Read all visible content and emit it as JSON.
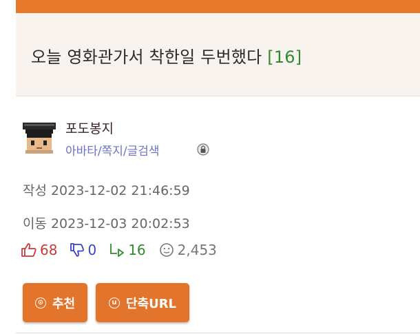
{
  "post": {
    "title": "오늘 영화관가서 착한일 두번했다",
    "comment_count": "[16]"
  },
  "author": {
    "nickname": "포도봉지",
    "links": "아바타/쪽지/글검색"
  },
  "meta": {
    "created_label": "작성",
    "created_value": "2023-12-02 21:46:59",
    "moved_label": "이동",
    "moved_value": "2023-12-03 20:02:53"
  },
  "stats": {
    "upvotes": "68",
    "downvotes": "0",
    "replies": "16",
    "views": "2,453"
  },
  "buttons": {
    "recommend": "추천",
    "recommend_icon": "⊙",
    "short_url": "단축URL",
    "short_url_icon": "u"
  },
  "colors": {
    "accent": "#e7792b",
    "upvote": "#c43b3b",
    "downvote": "#3546c2",
    "reply": "#2e8b2e"
  }
}
